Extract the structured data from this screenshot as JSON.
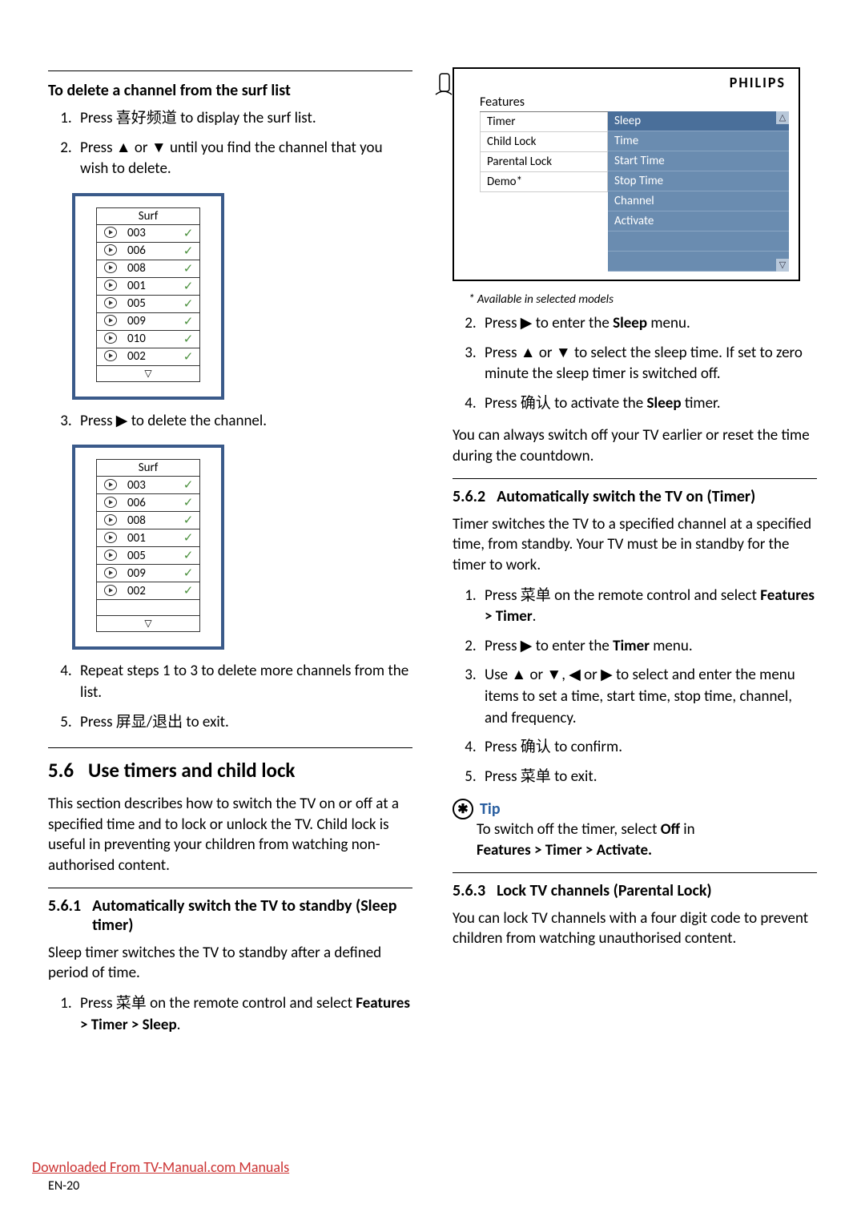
{
  "left": {
    "h3": "To delete a channel from the surf list",
    "steps_a": [
      "Press 喜好频道 to display the surf list.",
      "Press ▲ or ▼ until you find the channel that you wish to delete."
    ],
    "surf1": {
      "title": "Surf",
      "items": [
        "003",
        "006",
        "008",
        "001",
        "005",
        "009",
        "010",
        "002"
      ]
    },
    "step3": "Press ▶ to delete the channel.",
    "surf2": {
      "title": "Surf",
      "items": [
        "003",
        "006",
        "008",
        "001",
        "005",
        "009",
        "002"
      ]
    },
    "steps_b": [
      "Repeat steps 1 to 3 to delete more channels from the list.",
      "Press 屏显/退出 to exit."
    ],
    "h2_num": "5.6",
    "h2_txt": "Use timers and child lock",
    "p1": "This section describes how to switch the TV on or off at a specified time and to lock or unlock the TV. Child lock is useful in preventing your children from watching non-authorised content.",
    "h4a_num": "5.6.1",
    "h4a_txt": "Automatically switch the TV to standby (Sleep timer)",
    "p2": "Sleep timer switches the TV to standby after a defined period of time.",
    "step_sleep1_pre": "Press 菜单 on the remote control and select ",
    "step_sleep1_bold": "Features > Timer > Sleep",
    "step_sleep1_post": "."
  },
  "right": {
    "menu": {
      "brand": "PHILIPS",
      "path": "Features",
      "left_items": [
        "Timer",
        "Child Lock",
        "Parental Lock",
        "Demo*"
      ],
      "right_items": [
        "Sleep",
        "Time",
        "Start Time",
        "Stop Time",
        "Channel",
        "Activate"
      ]
    },
    "note": "* Available in selected models",
    "sleep_steps": [
      {
        "pre": "Press ▶ to enter the ",
        "bold": "Sleep",
        "post": " menu."
      },
      {
        "pre": "Press ▲ or ▼ to select the sleep time. If set to zero minute the sleep timer is switched off.",
        "bold": "",
        "post": ""
      },
      {
        "pre": "Press 确认 to activate the ",
        "bold": "Sleep",
        "post": " timer."
      }
    ],
    "p_after_sleep": "You can always switch off your TV earlier or reset the time during the countdown.",
    "h4b_num": "5.6.2",
    "h4b_txt": "Automatically switch the TV on (Timer)",
    "p_timer": "Timer switches the TV to a specified channel at a specified time, from standby. Your TV must be in standby for the timer to work.",
    "timer_steps": [
      {
        "pre": "Press 菜单 on the remote control and select ",
        "bold": "Features > Timer",
        "post": "."
      },
      {
        "pre": "Press ▶ to enter the ",
        "bold": "Timer",
        "post": " menu."
      },
      {
        "pre": "Use ▲ or ▼, ◀ or ▶ to select and enter the menu items to set a time, start time, stop time, channel, and frequency.",
        "bold": "",
        "post": ""
      },
      {
        "pre": "Press 确认 to confirm.",
        "bold": "",
        "post": ""
      },
      {
        "pre": "Press 菜单 to exit.",
        "bold": "",
        "post": ""
      }
    ],
    "tip_label": "Tip",
    "tip_pre": "To switch off the timer, select ",
    "tip_bold1": "Off",
    "tip_mid": " in ",
    "tip_bold2": "Features > Timer > Activate.",
    "h4c_num": "5.6.3",
    "h4c_txt": "Lock TV channels (Parental Lock)",
    "p_lock": "You can lock TV channels with a four digit code to prevent children from watching unauthorised content."
  },
  "footer": {
    "link": "Downloaded From TV-Manual.com Manuals",
    "page": "EN-20"
  }
}
